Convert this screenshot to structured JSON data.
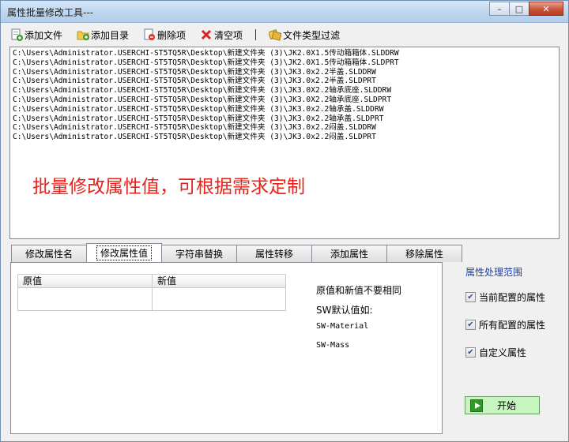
{
  "window": {
    "title": "属性批量修改工具---",
    "controls": {
      "minimize": "–",
      "maximize": "□",
      "close": "✕"
    }
  },
  "toolbar": {
    "add_file": "添加文件",
    "add_dir": "添加目录",
    "delete_item": "删除项",
    "clear_items": "清空项",
    "file_type_filter": "文件类型过滤"
  },
  "files": [
    "C:\\Users\\Administrator.USERCHI-ST5TQ5R\\Desktop\\新建文件夹 (3)\\JK2.0X1.5传动箱箱体.SLDDRW",
    "C:\\Users\\Administrator.USERCHI-ST5TQ5R\\Desktop\\新建文件夹 (3)\\JK2.0X1.5传动箱箱体.SLDPRT",
    "C:\\Users\\Administrator.USERCHI-ST5TQ5R\\Desktop\\新建文件夹 (3)\\JK3.0x2.2半盖.SLDDRW",
    "C:\\Users\\Administrator.USERCHI-ST5TQ5R\\Desktop\\新建文件夹 (3)\\JK3.0x2.2半盖.SLDPRT",
    "C:\\Users\\Administrator.USERCHI-ST5TQ5R\\Desktop\\新建文件夹 (3)\\JK3.0X2.2轴承底座.SLDDRW",
    "C:\\Users\\Administrator.USERCHI-ST5TQ5R\\Desktop\\新建文件夹 (3)\\JK3.0X2.2轴承底座.SLDPRT",
    "C:\\Users\\Administrator.USERCHI-ST5TQ5R\\Desktop\\新建文件夹 (3)\\JK3.0x2.2轴承盖.SLDDRW",
    "C:\\Users\\Administrator.USERCHI-ST5TQ5R\\Desktop\\新建文件夹 (3)\\JK3.0x2.2轴承盖.SLDPRT",
    "C:\\Users\\Administrator.USERCHI-ST5TQ5R\\Desktop\\新建文件夹 (3)\\JK3.0x2.2闷盖.SLDDRW",
    "C:\\Users\\Administrator.USERCHI-ST5TQ5R\\Desktop\\新建文件夹 (3)\\JK3.0x2.2闷盖.SLDPRT"
  ],
  "overlay": "批量修改属性值，可根据需求定制",
  "tabs": [
    "修改属性名",
    "修改属性值",
    "字符串替换",
    "属性转移",
    "添加属性",
    "移除属性"
  ],
  "active_tab": 1,
  "grid": {
    "col_old": "原值",
    "col_new": "新值"
  },
  "notes": {
    "differ": "原值和新值不要相同",
    "default_label": "SW默认值如:",
    "ex1": "SW-Material",
    "ex2": "SW-Mass"
  },
  "range": {
    "title": "属性处理范围",
    "current": "当前配置的属性",
    "all": "所有配置的属性",
    "custom": "自定义属性"
  },
  "start": "开始",
  "colors": {
    "overlay_red": "#e8221a",
    "range_blue": "#1a3fa8",
    "start_green": "#c7f5c0"
  }
}
